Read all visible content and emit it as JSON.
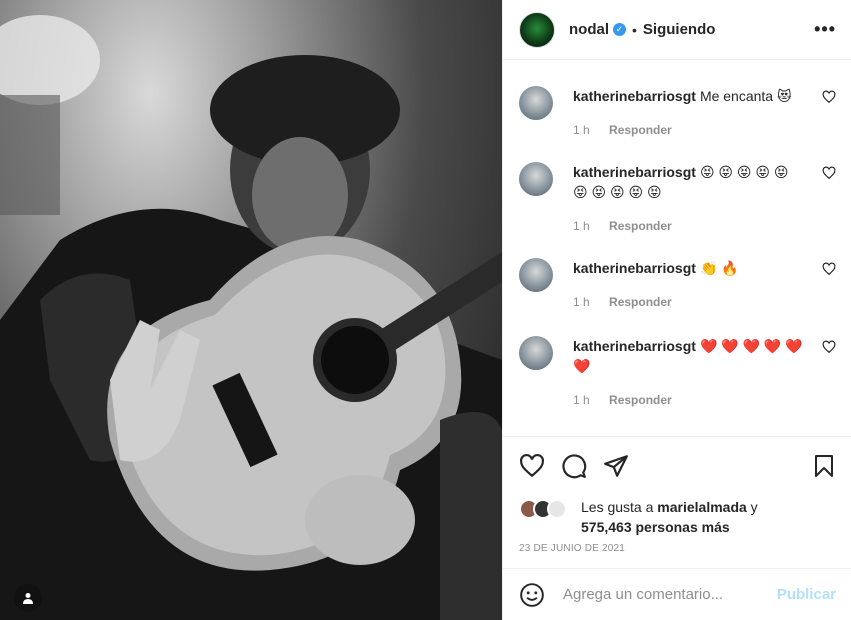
{
  "post": {
    "username": "nodal",
    "verified_glyph": "✓",
    "separator": "•",
    "follow_status": "Siguiendo",
    "more_glyph": "•••"
  },
  "comments": [
    {
      "user": "katherinebarriosgt",
      "text": "Me encanta 😻",
      "time": "1 h",
      "reply": "Responder"
    },
    {
      "user": "katherinebarriosgt",
      "text": "😝 😝 😝 😝 😝 😝 😝 😝 😝 😝",
      "time": "1 h",
      "reply": "Responder"
    },
    {
      "user": "katherinebarriosgt",
      "text": "👏 🔥",
      "time": "1 h",
      "reply": "Responder"
    },
    {
      "user": "katherinebarriosgt",
      "text": "❤️ ❤️ ❤️ ❤️ ❤️ ❤️",
      "time": "1 h",
      "reply": "Responder"
    }
  ],
  "likes": {
    "prefix": "Les gusta a ",
    "user": "marielalmada",
    "joiner": " y",
    "others": "575,463 personas más"
  },
  "date": "23 DE JUNIO DE 2021",
  "add_comment": {
    "placeholder": "Agrega un comentario...",
    "publish": "Publicar"
  },
  "icons": {
    "like": "heart-icon",
    "comment": "comment-icon",
    "share": "share-icon",
    "save": "bookmark-icon",
    "emoji": "emoji-icon",
    "tag": "user-tag-icon"
  }
}
